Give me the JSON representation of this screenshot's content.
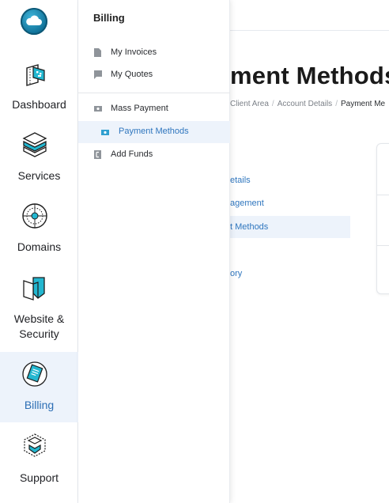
{
  "rail": {
    "items": [
      {
        "label": "Dashboard",
        "icon": "dashboard-icon"
      },
      {
        "label": "Services",
        "icon": "services-icon"
      },
      {
        "label": "Domains",
        "icon": "domains-icon"
      },
      {
        "label": "Website &",
        "label2": "Security",
        "icon": "website-security-icon"
      },
      {
        "label": "Billing",
        "icon": "billing-icon",
        "active": true
      },
      {
        "label": "Support",
        "icon": "support-icon"
      }
    ]
  },
  "flyout": {
    "title": "Billing",
    "items": [
      {
        "label": "My Invoices",
        "icon": "document-icon"
      },
      {
        "label": "My Quotes",
        "icon": "flag-icon"
      },
      {
        "label": "Mass Payment",
        "icon": "cash-icon"
      },
      {
        "label": "Payment Methods",
        "icon": "cash-icon",
        "active": true
      },
      {
        "label": "Add Funds",
        "icon": "bracket-icon"
      }
    ]
  },
  "main": {
    "title_visible": "ment Methods",
    "breadcrumb": [
      "Client Area",
      "Account Details",
      "Payment Me"
    ],
    "submenu": [
      "etails",
      "agement",
      "t Methods",
      "ory"
    ]
  },
  "colors": {
    "accent": "#2f76be",
    "active_bg": "#edf3fb",
    "icon_teal": "#23b7d0"
  }
}
